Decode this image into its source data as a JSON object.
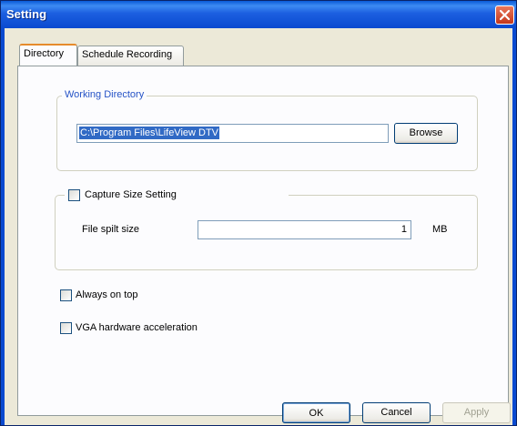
{
  "window": {
    "title": "Setting"
  },
  "tabs": [
    {
      "label": "Directory",
      "active": true
    },
    {
      "label": "Schedule Recording",
      "active": false
    }
  ],
  "working_directory": {
    "legend": "Working Directory",
    "path": "C:\\Program Files\\LifeView DTV",
    "browse_label": "Browse"
  },
  "capture_size": {
    "checkbox_label": "Capture Size Setting",
    "checked": false,
    "file_split_label": "File spilt size",
    "file_split_value": "1",
    "unit": "MB"
  },
  "options": {
    "always_on_top": {
      "label": "Always on top",
      "checked": false
    },
    "vga_accel": {
      "label": "VGA hardware acceleration",
      "checked": false
    }
  },
  "buttons": {
    "ok": "OK",
    "cancel": "Cancel",
    "apply": "Apply"
  },
  "colors": {
    "titlebar": "#0a4ad0",
    "legend_text": "#2653c6",
    "selection": "#316ac5"
  }
}
